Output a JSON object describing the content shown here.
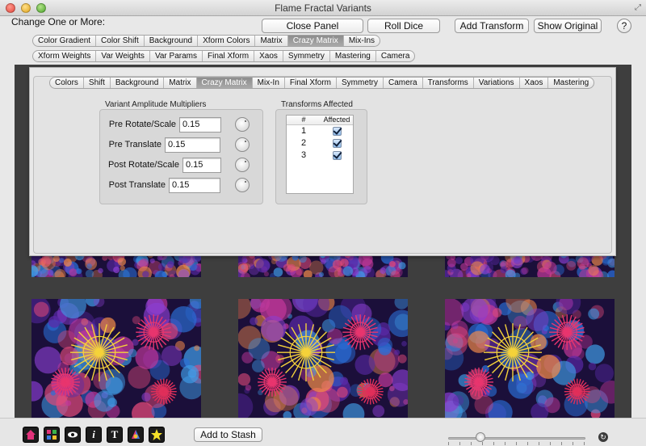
{
  "window": {
    "title": "Flame Fractal Variants"
  },
  "header": {
    "change_label": "Change One or More:",
    "close_panel": "Close Panel",
    "roll_dice": "Roll Dice",
    "add_transform": "Add Transform",
    "show_original": "Show Original",
    "help": "?"
  },
  "tabs_row1": [
    "Color Gradient",
    "Color Shift",
    "Background",
    "Xform Colors",
    "Matrix",
    "Crazy Matrix",
    "Mix-Ins"
  ],
  "tabs_row1_selected": "Crazy Matrix",
  "tabs_row2": [
    "Xform Weights",
    "Var Weights",
    "Var Params",
    "Final Xform",
    "Xaos",
    "Symmetry",
    "Mastering",
    "Camera"
  ],
  "panel": {
    "tabs": [
      "Colors",
      "Shift",
      "Background",
      "Matrix",
      "Crazy Matrix",
      "Mix-In",
      "Final Xform",
      "Symmetry",
      "Camera",
      "Transforms",
      "Variations",
      "Xaos",
      "Mastering"
    ],
    "selected_tab": "Crazy Matrix",
    "amplitude": {
      "title": "Variant Amplitude Multipliers",
      "rows": [
        {
          "label": "Pre Rotate/Scale",
          "value": "0.15"
        },
        {
          "label": "Pre Translate",
          "value": "0.15"
        },
        {
          "label": "Post Rotate/Scale",
          "value": "0.15"
        },
        {
          "label": "Post Translate",
          "value": "0.15"
        }
      ]
    },
    "transforms": {
      "title": "Transforms Affected",
      "col_num": "#",
      "col_affected": "Affected",
      "rows": [
        {
          "num": "1",
          "affected": true
        },
        {
          "num": "2",
          "affected": true
        },
        {
          "num": "3",
          "affected": true
        }
      ]
    }
  },
  "bottom": {
    "add_to_stash": "Add to Stash",
    "tools": [
      "home-icon",
      "grid-icon",
      "eye-icon",
      "info-icon",
      "text-icon",
      "palette-icon",
      "star-icon"
    ]
  },
  "colors": {
    "selected_tab": "#9a9a9a",
    "gallery_bg": "#3e3e3e",
    "checkbox": "#8fbbea"
  }
}
